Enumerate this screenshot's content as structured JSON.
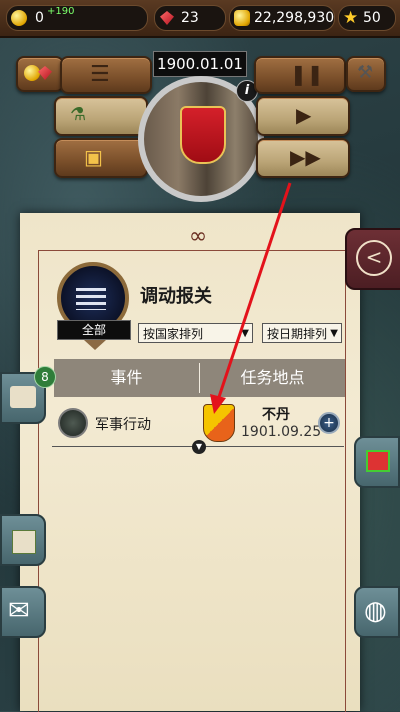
{
  "resources": {
    "gold": "0",
    "gold_delta": "+190",
    "gems": "23",
    "money": "22,298,930",
    "stars": "50"
  },
  "game": {
    "date": "1900.01.01"
  },
  "panel": {
    "title": "调动报关",
    "category_label": "全部",
    "sort_country": "按国家排列",
    "sort_date": "按日期排列"
  },
  "tabs": [
    {
      "label": "事件"
    },
    {
      "label": "任务地点"
    }
  ],
  "rows": [
    {
      "event": "军事行动",
      "country": "不丹",
      "date": "1901.09.25"
    }
  ],
  "badges": {
    "notifications": "8"
  },
  "colors": {
    "parchment": "#f3ead2",
    "accent_red": "#e3121b",
    "tab_bar": "#8e867a"
  },
  "icons": {
    "back": "chevron-left-icon",
    "mail": "envelope-icon",
    "globe": "globe-icon",
    "gift": "gift-icon",
    "scroll": "scroll-icon",
    "news": "newspaper-icon",
    "pause": "pause-icon",
    "play": "play-icon",
    "fast_forward": "fast-forward-icon",
    "menu": "menu-icon"
  }
}
